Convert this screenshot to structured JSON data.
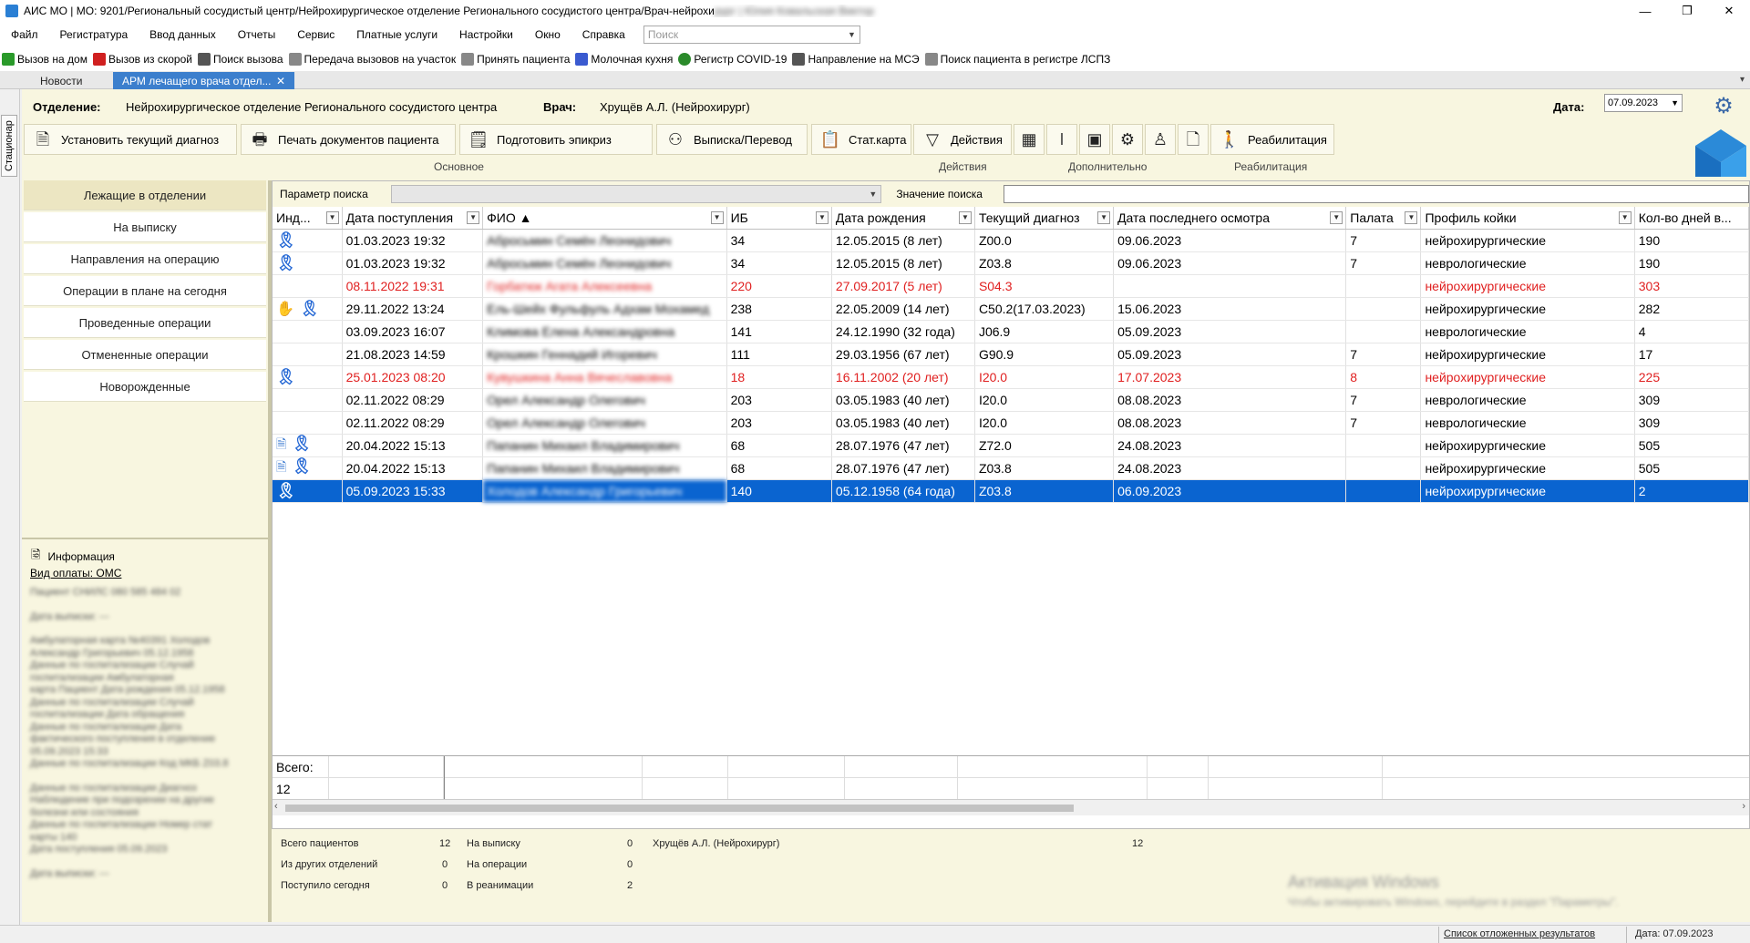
{
  "titlebar": {
    "title": "АИС МО | МО: 9201/Региональный сосудистый центр/Нейрохирургическое отделение Регионального сосудистого центра/Врач-нейрохи",
    "title_blurred": "рург | Юлия Ковальская Виктор",
    "min": "—",
    "max": "❐",
    "close": "✕"
  },
  "menu": {
    "items": [
      "Файл",
      "Регистратура",
      "Ввод данных",
      "Отчеты",
      "Сервис",
      "Платные услуги",
      "Настройки",
      "Окно",
      "Справка"
    ],
    "search_placeholder": "Поиск"
  },
  "quick_toolbar": [
    {
      "label": "Вызов на дом",
      "color": "#2a9a2a"
    },
    {
      "label": "Вызов из скорой",
      "color": "#d02020"
    },
    {
      "label": "Поиск вызова",
      "color": "#555555"
    },
    {
      "label": "Передача вызовов на участок",
      "color": "#777777"
    },
    {
      "label": "Принять пациента",
      "color": "#777777"
    },
    {
      "label": "Молочная кухня",
      "color": "#3a5ad0"
    },
    {
      "label": "Регистр COVID-19",
      "color": "#2a8a2a"
    },
    {
      "label": "Направление на МСЭ",
      "color": "#555555"
    },
    {
      "label": "Поиск пациента в регистре ЛСПЗ",
      "color": "#777777"
    }
  ],
  "tabs": {
    "news": "Новости",
    "arm": "АРМ лечащего врача отдел...",
    "close": "✕",
    "overflow": "▾"
  },
  "side_tab": "Стационар",
  "header": {
    "dept_label": "Отделение:",
    "dept_value": "Нейрохирургическое отделение Регионального сосудистого центра",
    "doctor_label": "Врач:",
    "doctor_value": "Хрущёв А.Л. (Нейрохирург)",
    "date_label": "Дата:",
    "date_value": "07.09.2023"
  },
  "ribbon": {
    "set_diagnosis": "Установить текущий диагноз",
    "print_docs": "Печать документов пациента",
    "prepare_epicrisis": "Подготовить эпикриз",
    "discharge": "Выписка/Перевод",
    "statcard": "Стат.карта",
    "actions": "Действия",
    "rehab": "Реабилитация",
    "group_main": "Основное",
    "group_actions": "Действия",
    "group_extra": "Дополнительно",
    "group_rehab": "Реабилитация"
  },
  "nav": {
    "items": [
      "Лежащие в отделении",
      "На выписку",
      "Направления на операцию",
      "Операции в плане на сегодня",
      "Проведенные операции",
      "Отмененные операции",
      "Новорожденные"
    ]
  },
  "info": {
    "title": "Информация",
    "payment": "Вид оплаты: ОМС",
    "blurred_lines": [
      "Пациент СНИЛС 080 585 484 02",
      "",
      "Дата выписки: ---",
      "",
      "Амбулаторная карта №40391 Холодов",
      "Александр Григорьевич 05.12.1958",
      "Данные по госпитализации Случай",
      "госпитализации Амбулаторная",
      "карта Пациент Дата рождения 05.12.1958",
      "Данные по госпитализации Случай",
      "госпитализации Дата обращения",
      "Данные по госпитализации Дата",
      "фактического поступления в отделение",
      "05.09.2023 15:33",
      "Данные по госпитализации Код МКБ Z03.8",
      "",
      "Данные по госпитализации Диагноз",
      "Наблюдение при подозрении на другие",
      "болезни или состояния",
      "Данные по госпитализации Номер стат",
      "карты 140",
      "Дата поступления 05.09.2023",
      "",
      "Дата выписки: ---"
    ]
  },
  "search": {
    "param_label": "Параметр поиска",
    "value_label": "Значение поиска"
  },
  "grid": {
    "columns": [
      "Инд...",
      "Дата поступления",
      "ФИО ▲",
      "ИБ",
      "Дата рождения",
      "Текущий диагноз",
      "Дата последнего осмотра",
      "Палата",
      "Профиль койки",
      "Кол-во дней в..."
    ],
    "rows": [
      {
        "ind": "ribbon",
        "admitted": "01.03.2023 19:32",
        "fio": "Абросьмин Семён Леонидович",
        "ib": "34",
        "dob": "12.05.2015 (8 лет)",
        "dx": "Z00.0",
        "last_exam": "09.06.2023",
        "ward": "7",
        "profile": "нейрохирургические",
        "days": "190",
        "style": ""
      },
      {
        "ind": "ribbon",
        "admitted": "01.03.2023 19:32",
        "fio": "Абросьмин Семён Леонидович",
        "ib": "34",
        "dob": "12.05.2015 (8 лет)",
        "dx": "Z03.8",
        "last_exam": "09.06.2023",
        "ward": "7",
        "profile": "неврологические",
        "days": "190",
        "style": ""
      },
      {
        "ind": "",
        "admitted": "08.11.2022 19:31",
        "fio": "Горбатюк Агата Алексеевна",
        "ib": "220",
        "dob": "27.09.2017 (5 лет)",
        "dx": "S04.3",
        "last_exam": "",
        "ward": "",
        "profile": "нейрохирургические",
        "days": "303",
        "style": "red"
      },
      {
        "ind": "hand-ribbon",
        "admitted": "29.11.2022 13:24",
        "fio": "Ель-Шейх Фульфуль Адхам Мохамед",
        "ib": "238",
        "dob": "22.05.2009 (14 лет)",
        "dx": "C50.2(17.03.2023)",
        "last_exam": "15.06.2023",
        "ward": "",
        "profile": "нейрохирургические",
        "days": "282",
        "style": ""
      },
      {
        "ind": "",
        "admitted": "03.09.2023 16:07",
        "fio": "Климова Елена Александровна",
        "ib": "141",
        "dob": "24.12.1990 (32 года)",
        "dx": "J06.9",
        "last_exam": "05.09.2023",
        "ward": "",
        "profile": "неврологические",
        "days": "4",
        "style": ""
      },
      {
        "ind": "",
        "admitted": "21.08.2023 14:59",
        "fio": "Крошкин Геннадий Игоревич",
        "ib": "111",
        "dob": "29.03.1956 (67 лет)",
        "dx": "G90.9",
        "last_exam": "05.09.2023",
        "ward": "7",
        "profile": "нейрохирургические",
        "days": "17",
        "style": ""
      },
      {
        "ind": "ribbon",
        "admitted": "25.01.2023 08:20",
        "fio": "Кувушкина Анна Вячеславовна",
        "ib": "18",
        "dob": "16.11.2002 (20 лет)",
        "dx": "I20.0",
        "last_exam": "17.07.2023",
        "ward": "8",
        "profile": "нейрохирургические",
        "days": "225",
        "style": "red"
      },
      {
        "ind": "",
        "admitted": "02.11.2022 08:29",
        "fio": "Орел Александр Олегович",
        "ib": "203",
        "dob": "03.05.1983 (40 лет)",
        "dx": "I20.0",
        "last_exam": "08.08.2023",
        "ward": "7",
        "profile": "неврологические",
        "days": "309",
        "style": ""
      },
      {
        "ind": "",
        "admitted": "02.11.2022 08:29",
        "fio": "Орел Александр Олегович",
        "ib": "203",
        "dob": "03.05.1983 (40 лет)",
        "dx": "I20.0",
        "last_exam": "08.08.2023",
        "ward": "7",
        "profile": "неврологические",
        "days": "309",
        "style": ""
      },
      {
        "ind": "doc-ribbon",
        "admitted": "20.04.2022 15:13",
        "fio": "Папанин Михаил Владимирович",
        "ib": "68",
        "dob": "28.07.1976 (47 лет)",
        "dx": "Z72.0",
        "last_exam": "24.08.2023",
        "ward": "",
        "profile": "нейрохирургические",
        "days": "505",
        "style": ""
      },
      {
        "ind": "doc-ribbon",
        "admitted": "20.04.2022 15:13",
        "fio": "Папанин Михаил Владимирович",
        "ib": "68",
        "dob": "28.07.1976 (47 лет)",
        "dx": "Z03.8",
        "last_exam": "24.08.2023",
        "ward": "",
        "profile": "нейрохирургические",
        "days": "505",
        "style": ""
      },
      {
        "ind": "ribbon",
        "admitted": "05.09.2023 15:33",
        "fio": "Холодов Александр Григорьевич",
        "ib": "140",
        "dob": "05.12.1958 (64 года)",
        "dx": "Z03.8",
        "last_exam": "06.09.2023",
        "ward": "",
        "profile": "нейрохирургические",
        "days": "2",
        "style": "sel"
      }
    ],
    "total_label": "Всего:",
    "total_value": "12"
  },
  "stats": {
    "total_patients_label": "Всего пациентов",
    "total_patients": "12",
    "from_other_label": "Из других отделений",
    "from_other": "0",
    "today_label": "Поступило сегодня",
    "today": "0",
    "to_discharge_label": "На выписку",
    "to_discharge": "0",
    "on_surgery_label": "На операции",
    "on_surgery": "0",
    "icu_label": "В реанимации",
    "icu": "2",
    "doctor": "Хрущёв А.Л. (Нейрохирург)",
    "doctor_count": "12"
  },
  "watermark": {
    "line1": "Активация Windows",
    "line2": "Чтобы активировать Windows, перейдите в раздел \"Параметры\"."
  },
  "statusbar": {
    "deferred": "Список отложенных результатов",
    "date": "Дата: 07.09.2023"
  },
  "colors": {
    "accent": "#0a64d0",
    "panel": "#f8f6e0",
    "warning": "#e02020",
    "tab_active": "#3c7fcd"
  }
}
